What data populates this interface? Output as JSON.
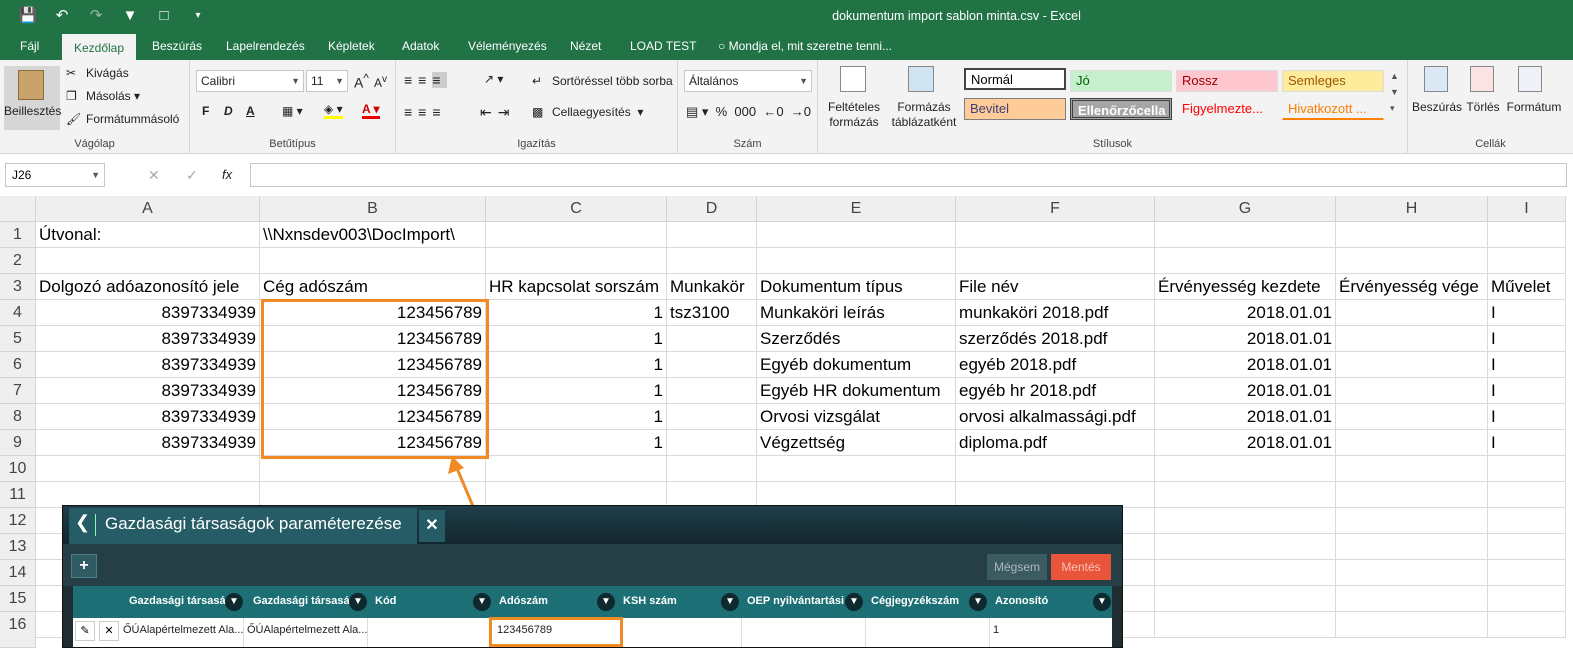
{
  "window": {
    "title": "dokumentum import sablon minta.csv - Excel"
  },
  "ribbon_tabs": [
    "Fájl",
    "Kezdőlap",
    "Beszúrás",
    "Lapelrendezés",
    "Képletek",
    "Adatok",
    "Véleményezés",
    "Nézet",
    "LOAD TEST",
    "Mondja el, mit szeretne tenni..."
  ],
  "clipboard": {
    "paste": "Beillesztés",
    "cut": "Kivágás",
    "copy": "Másolás",
    "format_painter": "Formátummásoló",
    "label": "Vágólap"
  },
  "font": {
    "name": "Calibri",
    "size": "11",
    "label": "Betűtípus",
    "bold": "F",
    "italic": "D",
    "underline": "A"
  },
  "alignment": {
    "wrap": "Sortöréssel több sorba",
    "merge": "Cellaegyesítés",
    "label": "Igazítás"
  },
  "number": {
    "format": "Általános",
    "label": "Szám"
  },
  "styles": {
    "cond": "Feltételes formázás",
    "table": "Formázás táblázatként",
    "normal": "Normál",
    "good": "Jó",
    "bad": "Rossz",
    "neutral": "Semleges",
    "input": "Bevitel",
    "check": "Ellenőrzőcella",
    "warn": "Figyelmezte...",
    "link": "Hivatkozott ...",
    "label": "Stílusok"
  },
  "cells_group": {
    "insert": "Beszúrás",
    "delete": "Törlés",
    "format": "Formátum",
    "label": "Cellák"
  },
  "formula_bar": {
    "namebox": "J26",
    "fx": "fx"
  },
  "columns": [
    "A",
    "B",
    "C",
    "D",
    "E",
    "F",
    "G",
    "H",
    "I"
  ],
  "rows": [
    "1",
    "2",
    "3",
    "4",
    "5",
    "6",
    "7",
    "8",
    "9",
    "10",
    "11",
    "12",
    "13",
    "14",
    "15",
    "16"
  ],
  "sheet": {
    "r1": {
      "a": "Útvonal:",
      "b": "\\\\Nxnsdev003\\DocImport\\"
    },
    "r3": {
      "a": "Dolgozó adóazonosító jele",
      "b": "Cég adószám",
      "c": "HR kapcsolat sorszám",
      "d": "Munkakör",
      "e": "Dokumentum típus",
      "f": "File név",
      "g": "Érvényesség kezdete",
      "h": "Érvényesség vége",
      "i": "Művelet"
    },
    "data": [
      {
        "a": "8397334939",
        "b": "123456789",
        "c": "1",
        "d": "tsz3100",
        "e": "Munkaköri leírás",
        "f": "munkaköri 2018.pdf",
        "g": "2018.01.01",
        "i": "I"
      },
      {
        "a": "8397334939",
        "b": "123456789",
        "c": "1",
        "d": "",
        "e": "Szerződés",
        "f": "szerződés 2018.pdf",
        "g": "2018.01.01",
        "i": "I"
      },
      {
        "a": "8397334939",
        "b": "123456789",
        "c": "1",
        "d": "",
        "e": "Egyéb dokumentum",
        "f": "egyéb 2018.pdf",
        "g": "2018.01.01",
        "i": "I"
      },
      {
        "a": "8397334939",
        "b": "123456789",
        "c": "1",
        "d": "",
        "e": "Egyéb HR dokumentum",
        "f": "egyéb hr 2018.pdf",
        "g": "2018.01.01",
        "i": "I"
      },
      {
        "a": "8397334939",
        "b": "123456789",
        "c": "1",
        "d": "",
        "e": "Orvosi vizsgálat",
        "f": "orvosi alkalmassági.pdf",
        "g": "2018.01.01",
        "i": "I"
      },
      {
        "a": "8397334939",
        "b": "123456789",
        "c": "1",
        "d": "",
        "e": "Végzettség",
        "f": "diploma.pdf",
        "g": "2018.01.01",
        "i": "I"
      }
    ]
  },
  "dialog": {
    "title": "Gazdasági társaságok paraméterezése",
    "add": "+",
    "cancel": "Mégsem",
    "save": "Mentés",
    "headers": [
      "Gazdasági társasá...",
      "Gazdasági társasá...",
      "Kód",
      "Adószám",
      "KSH szám",
      "OEP nyilvántartási ...",
      "Cégjegyzékszám",
      "Azonosító"
    ],
    "row": [
      "ŐÚAlapértelmezett Ala...",
      "ŐÚAlapértelmezett Ala...",
      "",
      "123456789",
      "",
      "",
      "",
      "1"
    ]
  },
  "colors": {
    "excel_green": "#217346",
    "highlight": "#f08a24"
  }
}
